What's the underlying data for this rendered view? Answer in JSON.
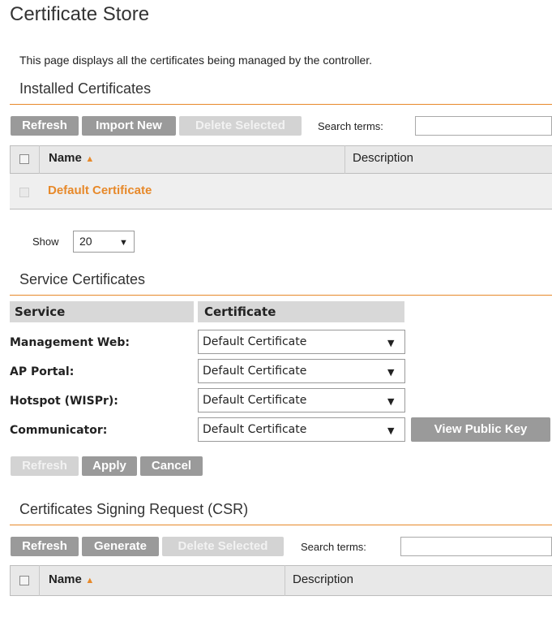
{
  "page": {
    "title": "Certificate Store",
    "intro": "This page displays all the certificates being managed by the controller."
  },
  "installed": {
    "section_title": "Installed Certificates",
    "buttons": {
      "refresh": "Refresh",
      "import_new": "Import New",
      "delete_selected": "Delete Selected"
    },
    "search_label": "Search terms:",
    "search_value": "",
    "columns": {
      "name": "Name",
      "description": "Description"
    },
    "rows": [
      {
        "name": "Default Certificate",
        "description": ""
      }
    ],
    "show_label": "Show",
    "show_value": "20"
  },
  "service": {
    "section_title": "Service Certificates",
    "columns": {
      "service": "Service",
      "certificate": "Certificate"
    },
    "rows": [
      {
        "label": "Management Web:",
        "value": "Default Certificate"
      },
      {
        "label": "AP Portal:",
        "value": "Default Certificate"
      },
      {
        "label": "Hotspot (WISPr):",
        "value": "Default Certificate"
      },
      {
        "label": "Communicator:",
        "value": "Default Certificate"
      }
    ],
    "view_public_key": "View Public Key",
    "buttons": {
      "refresh": "Refresh",
      "apply": "Apply",
      "cancel": "Cancel"
    }
  },
  "csr": {
    "section_title": "Certificates Signing Request (CSR)",
    "buttons": {
      "refresh": "Refresh",
      "generate": "Generate",
      "delete_selected": "Delete Selected"
    },
    "search_label": "Search terms:",
    "search_value": "",
    "columns": {
      "name": "Name",
      "description": "Description"
    }
  },
  "colors": {
    "accent": "#e7892a",
    "button": "#9a9a9a",
    "button_disabled": "#d3d3d3",
    "header_bg": "#e8e8e8"
  },
  "icons": {
    "sort": "sort-ascending-icon",
    "dropdown": "chevron-down-icon"
  }
}
